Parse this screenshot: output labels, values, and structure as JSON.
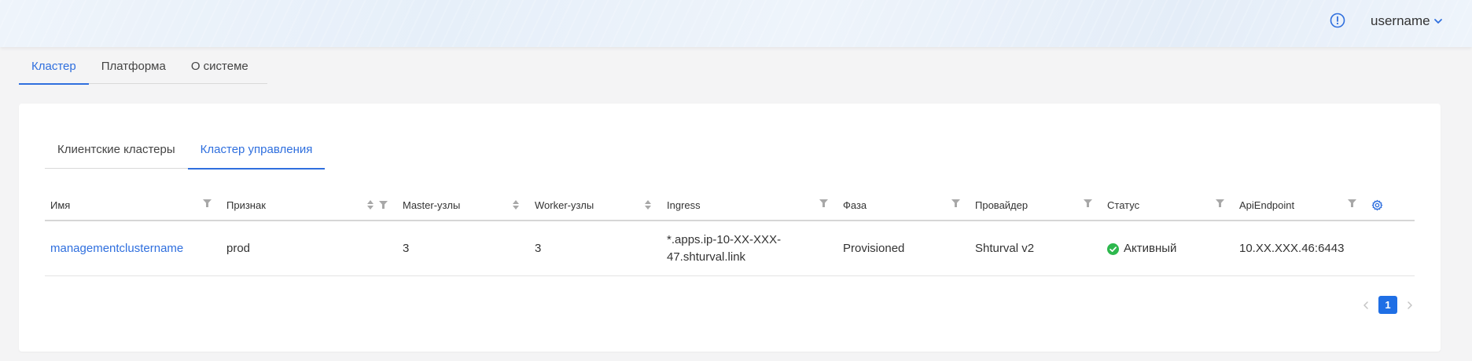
{
  "header": {
    "username": "username"
  },
  "top_tabs": [
    {
      "label": "Кластер",
      "active": true
    },
    {
      "label": "Платформа",
      "active": false
    },
    {
      "label": "О системе",
      "active": false
    }
  ],
  "sub_tabs": [
    {
      "label": "Клиентские кластеры",
      "active": false
    },
    {
      "label": "Кластер управления",
      "active": true
    }
  ],
  "table": {
    "columns": [
      {
        "label": "Имя"
      },
      {
        "label": "Признак"
      },
      {
        "label": "Master-узлы"
      },
      {
        "label": "Worker-узлы"
      },
      {
        "label": "Ingress"
      },
      {
        "label": "Фаза"
      },
      {
        "label": "Провайдер"
      },
      {
        "label": "Статус"
      },
      {
        "label": "ApiEndpoint"
      }
    ],
    "rows": [
      {
        "name": "managementclustername",
        "tag": "prod",
        "master": "3",
        "worker": "3",
        "ingress": "*.apps.ip-10-XX-XXX-47.shturval.link",
        "phase": "Provisioned",
        "provider": "Shturval v2",
        "status": "Активный",
        "api_endpoint": "10.XX.XXX.46:6443"
      }
    ]
  },
  "pagination": {
    "current_page": "1"
  },
  "colors": {
    "accent": "#2f6fde",
    "status_ok": "#2db84d",
    "page_active": "#1f6fe5"
  }
}
